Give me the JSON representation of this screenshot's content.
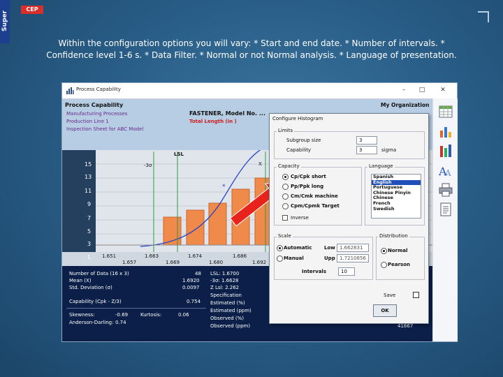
{
  "slide": {
    "brand_vertical": "Super",
    "brand_badge": "CEP",
    "caption": "Within the configuration options you will vary: * Start and end date. * Number of intervals. * Confidence level 1-6 s. * Data Filter. * Normal or not Normal analysis. * Language of presentation."
  },
  "window": {
    "title": "Process Capability",
    "minimize": "–",
    "maximize": "□",
    "close": "✕"
  },
  "header": {
    "report_title": "Process Capability",
    "organization": "My Organization",
    "line1": "Manufacturing Processes",
    "line2": "Production Line 1",
    "line3": "Inspection Sheet for ABC Model",
    "model": "FASTENER, Model No. ...",
    "measure": "Total Length (in   )"
  },
  "plot": {
    "lsl_label": "LSL",
    "minus3s_label": "-3σ",
    "x_label": "X",
    "mean_marker": "*",
    "y_ticks": [
      "15",
      "13",
      "11",
      "9",
      "7",
      "5",
      "3",
      "1"
    ],
    "x_ticks_top": [
      "1.651",
      "1.663",
      "1.674",
      "1.686"
    ],
    "x_ticks_bottom": [
      "1.657",
      "1.669",
      "1.680",
      "1.692"
    ],
    "colors": {
      "bar": "#f08a4b",
      "curve": "#2a44c8",
      "lsl": "#2e9a3c",
      "arrow": "#e8231b"
    }
  },
  "stats": {
    "num_data_label": "Number of Data  (16 x 3)",
    "num_data": "48",
    "mean_label": "Mean (X)",
    "mean": "1.6920",
    "std_label": "Std. Deviation (σ)",
    "std": "0.0097",
    "capability_label": "Capability (Cpk - Z/3)",
    "capability": "0.754",
    "skew_label": "Skewness:",
    "skew": "-0.69",
    "kurt_label": "Kurtosis:",
    "kurt": "0.06",
    "ad_label": "Anderson-Darling:",
    "ad": "0.74",
    "lsl_stat": "LSL: 1.6700",
    "m3s_stat": "-3σ: 1.6628",
    "zlsl_stat": "Z Lsl: 2.262",
    "spec_label": "Specification",
    "est_pct": "Estimated (%)",
    "est_ppm": "Estimated (ppm)",
    "obs_pct": "Observed (%)",
    "obs_ppm": "Observed (ppm)",
    "obs_ppm_value": "41667"
  },
  "dialog": {
    "title": "Configure Histogram",
    "limits_label": "Limits",
    "subgroup_label": "Subgroup size",
    "subgroup_value": "3",
    "capability_label": "Capability",
    "capability_value": "3",
    "sigma_label": "sigma",
    "capacity_label": "Capacity",
    "capacity_options": [
      "Cp/Cpk short",
      "Pp/Ppk long",
      "Cm/Cmk machine",
      "Cpm/Cpmk Target"
    ],
    "capacity_selected": 0,
    "inverse_label": "Inverse",
    "language_label": "Language",
    "languages": [
      "Spanish",
      "English",
      "Portuguese",
      "Chinese Pinyin",
      "Chinese",
      "French",
      "Swedish"
    ],
    "language_selected": 1,
    "scale_label": "Scale",
    "automatic_label": "Automatic",
    "manual_label": "Manual",
    "low_label": "Low",
    "low_value": "1.662831",
    "upp_label": "Upp",
    "upp_value": "1.7210856",
    "intervals_label": "Intervals",
    "intervals_value": "10",
    "distribution_label": "Distribution",
    "normal_label": "Normal",
    "pearson_label": "Pearson",
    "save_label": "Save",
    "ok_label": "OK"
  }
}
